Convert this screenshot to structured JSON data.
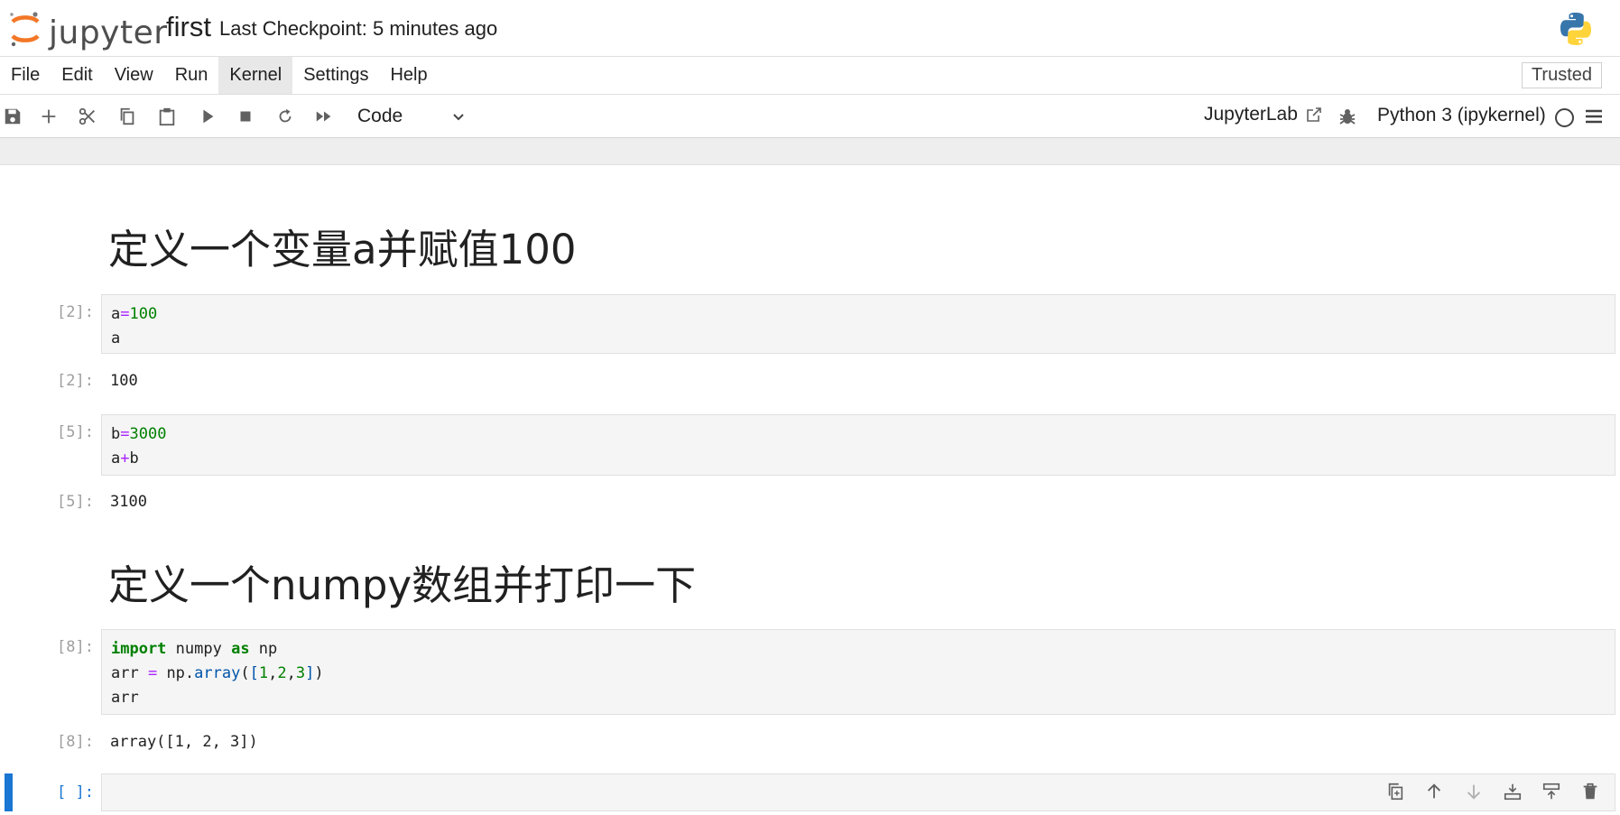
{
  "header": {
    "logo_text": "jupyter",
    "notebook_name": "first",
    "checkpoint": "Last Checkpoint: 5 minutes ago"
  },
  "menubar": {
    "items": [
      "File",
      "Edit",
      "View",
      "Run",
      "Kernel",
      "Settings",
      "Help"
    ],
    "active": "Kernel",
    "trusted_label": "Trusted"
  },
  "toolbar": {
    "cell_type": "Code",
    "jupyterlab_label": "JupyterLab",
    "kernel_name": "Python 3 (ipykernel)",
    "buttons": [
      "save-icon",
      "plus-icon",
      "cut-icon",
      "copy-icon",
      "paste-icon",
      "run-icon",
      "stop-icon",
      "restart-icon",
      "fast-forward-icon"
    ]
  },
  "cells": {
    "heading1": "定义一个变量a并赋值100",
    "cell1": {
      "prompt": "[2]:",
      "out_prompt": "[2]:",
      "output": "100"
    },
    "cell2": {
      "prompt": "[5]:",
      "out_prompt": "[5]:",
      "output": "3100"
    },
    "heading2": "定义一个numpy数组并打印一下",
    "cell3": {
      "prompt": "[8]:",
      "out_prompt": "[8]:",
      "output": "array([1, 2, 3])"
    },
    "cell4": {
      "prompt": "[ ]:"
    }
  },
  "colors": {
    "accent": "#1976d2",
    "logo_orange": "#f37726",
    "keyword": "#008000",
    "operator": "#aa22ff"
  }
}
